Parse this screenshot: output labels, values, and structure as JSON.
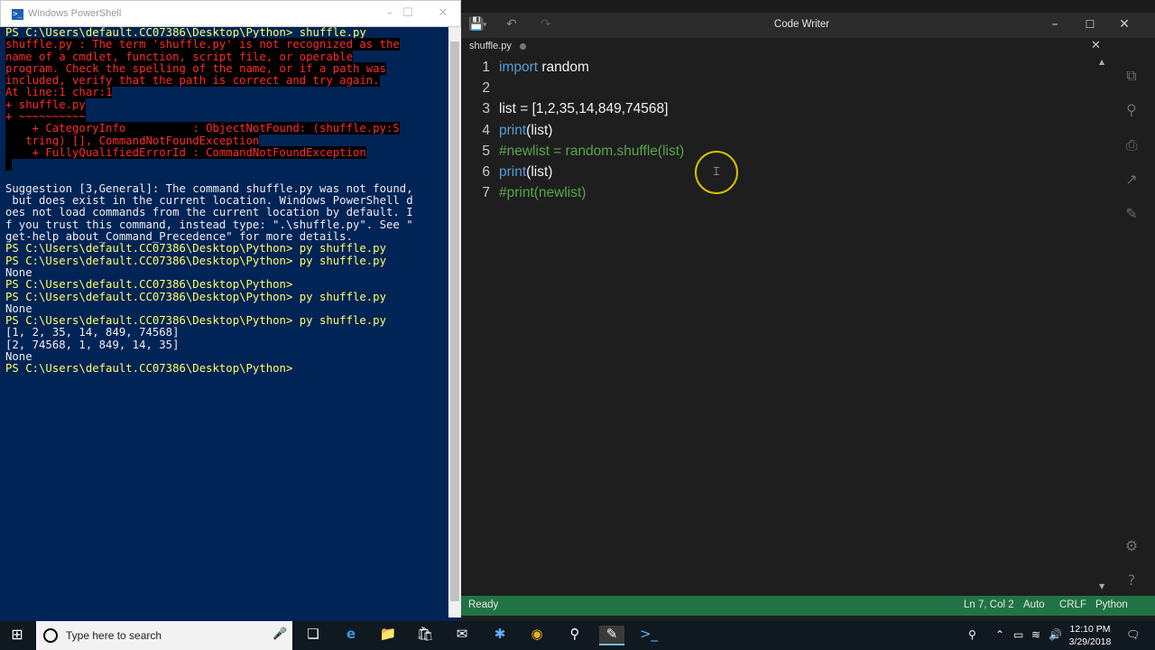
{
  "powershell": {
    "title": "Windows PowerShell",
    "lines": [
      {
        "type": "cmd",
        "prompt": "PS C:\\Users\\default.CC07386\\Desktop\\Python> ",
        "command": "shuffle.py"
      },
      {
        "type": "err",
        "text": "shuffle.py : The term 'shuffle.py' is not recognized as the"
      },
      {
        "type": "err",
        "text": "name of a cmdlet, function, script file, or operable"
      },
      {
        "type": "err",
        "text": "program. Check the spelling of the name, or if a path was"
      },
      {
        "type": "err",
        "text": "included, verify that the path is correct and try again."
      },
      {
        "type": "err",
        "text": "At line:1 char:1"
      },
      {
        "type": "err",
        "text": "+ shuffle.py"
      },
      {
        "type": "err",
        "text": "+ ~~~~~~~~~~"
      },
      {
        "type": "err",
        "text": "    + CategoryInfo          : ObjectNotFound: (shuffle.py:S"
      },
      {
        "type": "err",
        "text": "   tring) [], CommandNotFoundException"
      },
      {
        "type": "err",
        "text": "    + FullyQualifiedErrorId : CommandNotFoundException"
      },
      {
        "type": "err",
        "text": " "
      },
      {
        "type": "out",
        "text": ""
      },
      {
        "type": "out",
        "text": "Suggestion [3,General]: The command shuffle.py was not found,"
      },
      {
        "type": "out",
        "text": " but does exist in the current location. Windows PowerShell d"
      },
      {
        "type": "out",
        "text": "oes not load commands from the current location by default. I"
      },
      {
        "type": "out",
        "text": "f you trust this command, instead type: \".\\shuffle.py\". See \""
      },
      {
        "type": "out",
        "text": "get-help about_Command_Precedence\" for more details."
      },
      {
        "type": "cmd",
        "prompt": "PS C:\\Users\\default.CC07386\\Desktop\\Python> ",
        "command": "py shuffle.py"
      },
      {
        "type": "cmd",
        "prompt": "PS C:\\Users\\default.CC07386\\Desktop\\Python> ",
        "command": "py shuffle.py"
      },
      {
        "type": "out",
        "text": "None"
      },
      {
        "type": "cmd",
        "prompt": "PS C:\\Users\\default.CC07386\\Desktop\\Python> ",
        "command": ""
      },
      {
        "type": "cmd",
        "prompt": "PS C:\\Users\\default.CC07386\\Desktop\\Python> ",
        "command": "py shuffle.py"
      },
      {
        "type": "out",
        "text": "None"
      },
      {
        "type": "cmd",
        "prompt": "PS C:\\Users\\default.CC07386\\Desktop\\Python> ",
        "command": "py shuffle.py"
      },
      {
        "type": "out",
        "text": "[1, 2, 35, 14, 849, 74568]"
      },
      {
        "type": "out",
        "text": "[2, 74568, 1, 849, 14, 35]"
      },
      {
        "type": "out",
        "text": "None"
      },
      {
        "type": "cmd",
        "prompt": "PS C:\\Users\\default.CC07386\\Desktop\\Python> ",
        "command": ""
      }
    ]
  },
  "codewriter": {
    "title": "Code Writer",
    "tab_name": "shuffle.py",
    "code_lines": [
      {
        "num": "1",
        "tokens": [
          {
            "t": "import",
            "c": "kw"
          },
          {
            "t": " random",
            "c": ""
          }
        ]
      },
      {
        "num": "2",
        "tokens": []
      },
      {
        "num": "3",
        "tokens": [
          {
            "t": "list = [1,2,35,14,849,74568]",
            "c": ""
          }
        ]
      },
      {
        "num": "4",
        "tokens": [
          {
            "t": "print",
            "c": "kw"
          },
          {
            "t": "(list)",
            "c": ""
          }
        ]
      },
      {
        "num": "5",
        "tokens": [
          {
            "t": "#newlist = random.shuffle(list)",
            "c": "cm"
          }
        ]
      },
      {
        "num": "6",
        "tokens": [
          {
            "t": "print",
            "c": "kw"
          },
          {
            "t": "(list)",
            "c": ""
          }
        ]
      },
      {
        "num": "7",
        "tokens": [
          {
            "t": "#print(newlist)",
            "c": "cm"
          }
        ]
      }
    ],
    "status": {
      "state": "Ready",
      "position": "Ln 7, Col 2",
      "encoding": "Auto",
      "line_ending": "CRLF",
      "language": "Python"
    }
  },
  "taskbar": {
    "search_placeholder": "Type here to search",
    "time": "12:10 PM",
    "date": "3/29/2018"
  }
}
